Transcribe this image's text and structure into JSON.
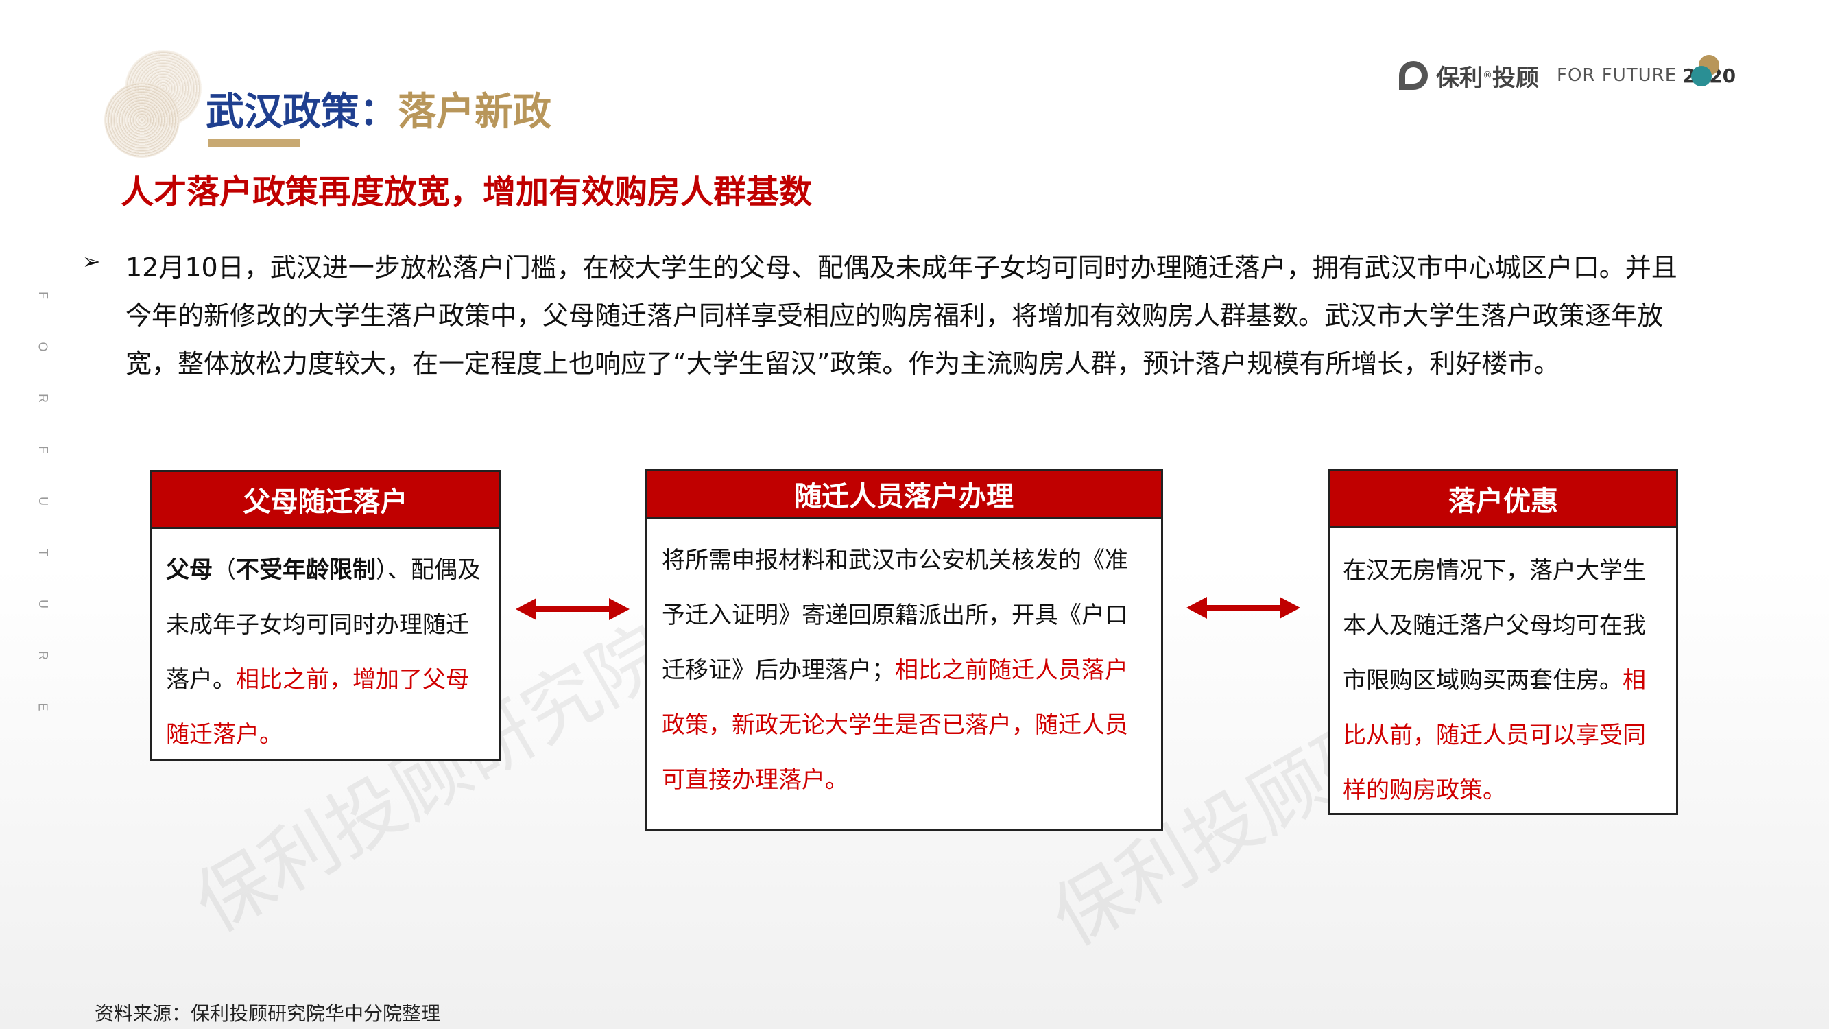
{
  "header": {
    "title_main": "武汉政策",
    "title_sep": "：",
    "title_sub": "落户新政",
    "subtitle": "人才落户政策再度放宽，增加有效购房人群基数"
  },
  "logo": {
    "name": "保利",
    "reg": "®",
    "name2": "投顾",
    "tagline": "FOR FUTURE",
    "year": "2020"
  },
  "side_letters": [
    "F",
    "O",
    "R",
    "F",
    "U",
    "T",
    "U",
    "R",
    "E"
  ],
  "paragraph": {
    "bullet": "➢",
    "text": "12月10日，武汉进一步放松落户门槛，在校大学生的父母、配偶及未成年子女均可同时办理随迁落户，拥有武汉市中心城区户口。并且今年的新修改的大学生落户政策中，父母随迁落户同样享受相应的购房福利，将增加有效购房人群基数。武汉市大学生落户政策逐年放宽，整体放松力度较大，在一定程度上也响应了“大学生留汉”政策。作为主流购房人群，预计落户规模有所增长，利好楼市。"
  },
  "boxes": {
    "box1": {
      "title": "父母随迁落户",
      "bold1": "父母",
      "paren_open": "（",
      "bold2": "不受年龄限制",
      "paren_close": "）",
      "normal": "、配偶及未成年子女均可同时办理随迁落户。",
      "red": "相比之前，增加了父母随迁落户。"
    },
    "box2": {
      "title": "随迁人员落户办理",
      "normal": "将所需申报材料和武汉市公安机关核发的《准予迁入证明》寄递回原籍派出所，开具《户口迁移证》后办理落户；",
      "red": "相比之前随迁人员落户政策，新政无论大学生是否已落户，随迁人员可直接办理落户。"
    },
    "box3": {
      "title": "落户优惠",
      "normal": "在汉无房情况下，落户大学生本人及随迁落户父母均可在我市限购区域购买两套住房。",
      "red": "相比从前，随迁人员可以享受同样的购房政策。"
    }
  },
  "watermark": "保利投顾研究院",
  "source": "资料来源：保利投顾研究院华中分院整理",
  "colors": {
    "title_blue": "#1f3f8f",
    "gold": "#b8965a",
    "red": "#c00000"
  }
}
